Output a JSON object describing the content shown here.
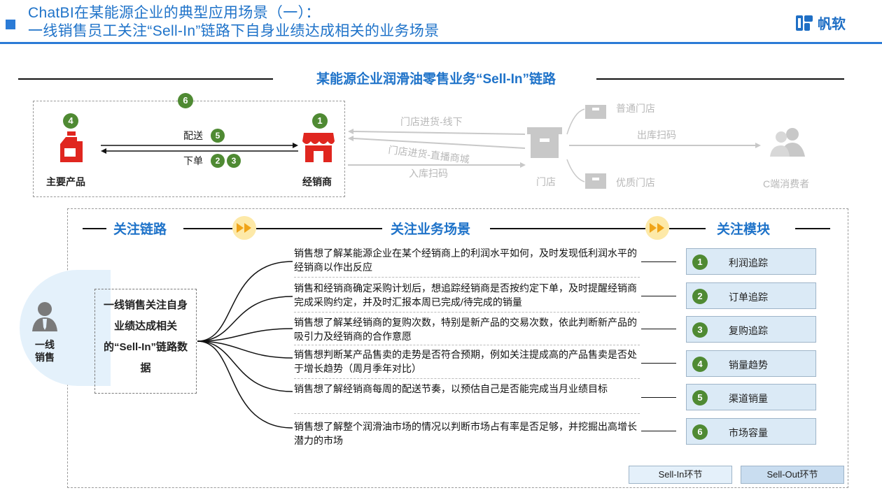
{
  "header": {
    "title_line1": "ChatBI在某能源企业的典型应用场景（一）：",
    "title_line2": "一线销售员工关注“Sell-In”链路下自身业绩达成相关的业务场景",
    "logo_text": "帆软"
  },
  "section_title": "某能源企业润滑油零售业务“Sell-In”链路",
  "flow": {
    "main_product": "主要产品",
    "distributor": "经销商",
    "deliver": "配送",
    "order": "下单",
    "store": "门店",
    "normal_store": "普通门店",
    "premium_store": "优质门店",
    "consumer": "C端消费者",
    "store_purchase_offline": "门店进货-线下",
    "store_purchase_platform": "门店进货-直播商城",
    "inbound_scan": "入库扫码",
    "outbound_scan": "出库扫码",
    "num_1": "1",
    "num_2": "2",
    "num_3": "3",
    "num_4": "4",
    "num_5": "5",
    "num_6": "6"
  },
  "focus": {
    "chain_title": "关注链路",
    "scenario_title": "关注业务场景",
    "module_title": "关注模块",
    "role_label": "一线\n销售",
    "chain_box": "一线销售关注自身业绩达成相关的“Sell-In”链路数据"
  },
  "scenarios": [
    "销售想了解某能源企业在某个经销商上的利润水平如何，及时发现低利润水平的经销商以作出反应",
    "销售和经销商确定采购计划后，想追踪经销商是否按约定下单，及时提醒经销商完成采购约定，并及时汇报本周已完成/待完成的销量",
    "销售想了解某经销商的复购次数，特别是新产品的交易次数，依此判断新产品的吸引力及经销商的合作意愿",
    "销售想判断某产品售卖的走势是否符合预期，例如关注提成高的产品售卖是否处于增长趋势（周月季年对比）",
    "销售想了解经销商每周的配送节奏，以预估自己是否能完成当月业绩目标",
    "销售想了解整个润滑油市场的情况以判断市场占有率是否足够，并挖掘出高增长潜力的市场"
  ],
  "modules": [
    {
      "num": "1",
      "label": "利润追踪"
    },
    {
      "num": "2",
      "label": "订单追踪"
    },
    {
      "num": "3",
      "label": "复购追踪"
    },
    {
      "num": "4",
      "label": "销量趋势"
    },
    {
      "num": "5",
      "label": "渠道销量"
    },
    {
      "num": "6",
      "label": "市场容量"
    }
  ],
  "legend": {
    "sell_in": "Sell-In环节",
    "sell_out": "Sell-Out环节"
  },
  "colors": {
    "brand_blue": "#1f73c9",
    "green_badge": "#4f8a33",
    "red_icon": "#e0261f",
    "module_fill": "#dbeaf6",
    "sell_out_fill": "#c9ddf0"
  }
}
